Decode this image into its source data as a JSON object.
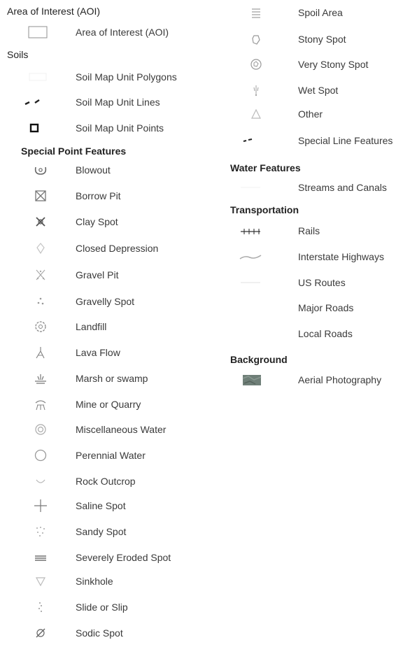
{
  "sections": {
    "aoi": "Area of Interest (AOI)",
    "soils": "Soils",
    "special_point_features": "Special Point Features",
    "water_features": "Water Features",
    "transportation": "Transportation",
    "background": "Background"
  },
  "items": {
    "aoi": "Area of Interest (AOI)",
    "soil_polygons": "Soil Map Unit Polygons",
    "soil_lines": "Soil Map Unit Lines",
    "soil_points": "Soil Map Unit Points",
    "blowout": "Blowout",
    "borrow_pit": "Borrow Pit",
    "clay_spot": "Clay Spot",
    "closed_depression": "Closed Depression",
    "gravel_pit": "Gravel Pit",
    "gravelly_spot": "Gravelly Spot",
    "landfill": "Landfill",
    "lava_flow": "Lava Flow",
    "marsh": "Marsh or swamp",
    "mine": "Mine or Quarry",
    "misc_water": "Miscellaneous Water",
    "perennial_water": "Perennial Water",
    "rock_outcrop": "Rock Outcrop",
    "saline_spot": "Saline Spot",
    "sandy_spot": "Sandy Spot",
    "eroded_spot": "Severely Eroded Spot",
    "sinkhole": "Sinkhole",
    "slide": "Slide or Slip",
    "sodic_spot": "Sodic Spot",
    "spoil_area": "Spoil Area",
    "stony_spot": "Stony Spot",
    "very_stony_spot": "Very Stony Spot",
    "wet_spot": "Wet Spot",
    "other": "Other",
    "special_line": "Special Line Features",
    "streams": "Streams and Canals",
    "rails": "Rails",
    "interstate": "Interstate Highways",
    "us_routes": "US Routes",
    "major_roads": "Major Roads",
    "local_roads": "Local Roads",
    "aerial": "Aerial Photography"
  },
  "colors": {
    "symbol_gray": "#9a9a9a",
    "symbol_dark": "#222222",
    "aerial_photo": "#6f7f78"
  }
}
